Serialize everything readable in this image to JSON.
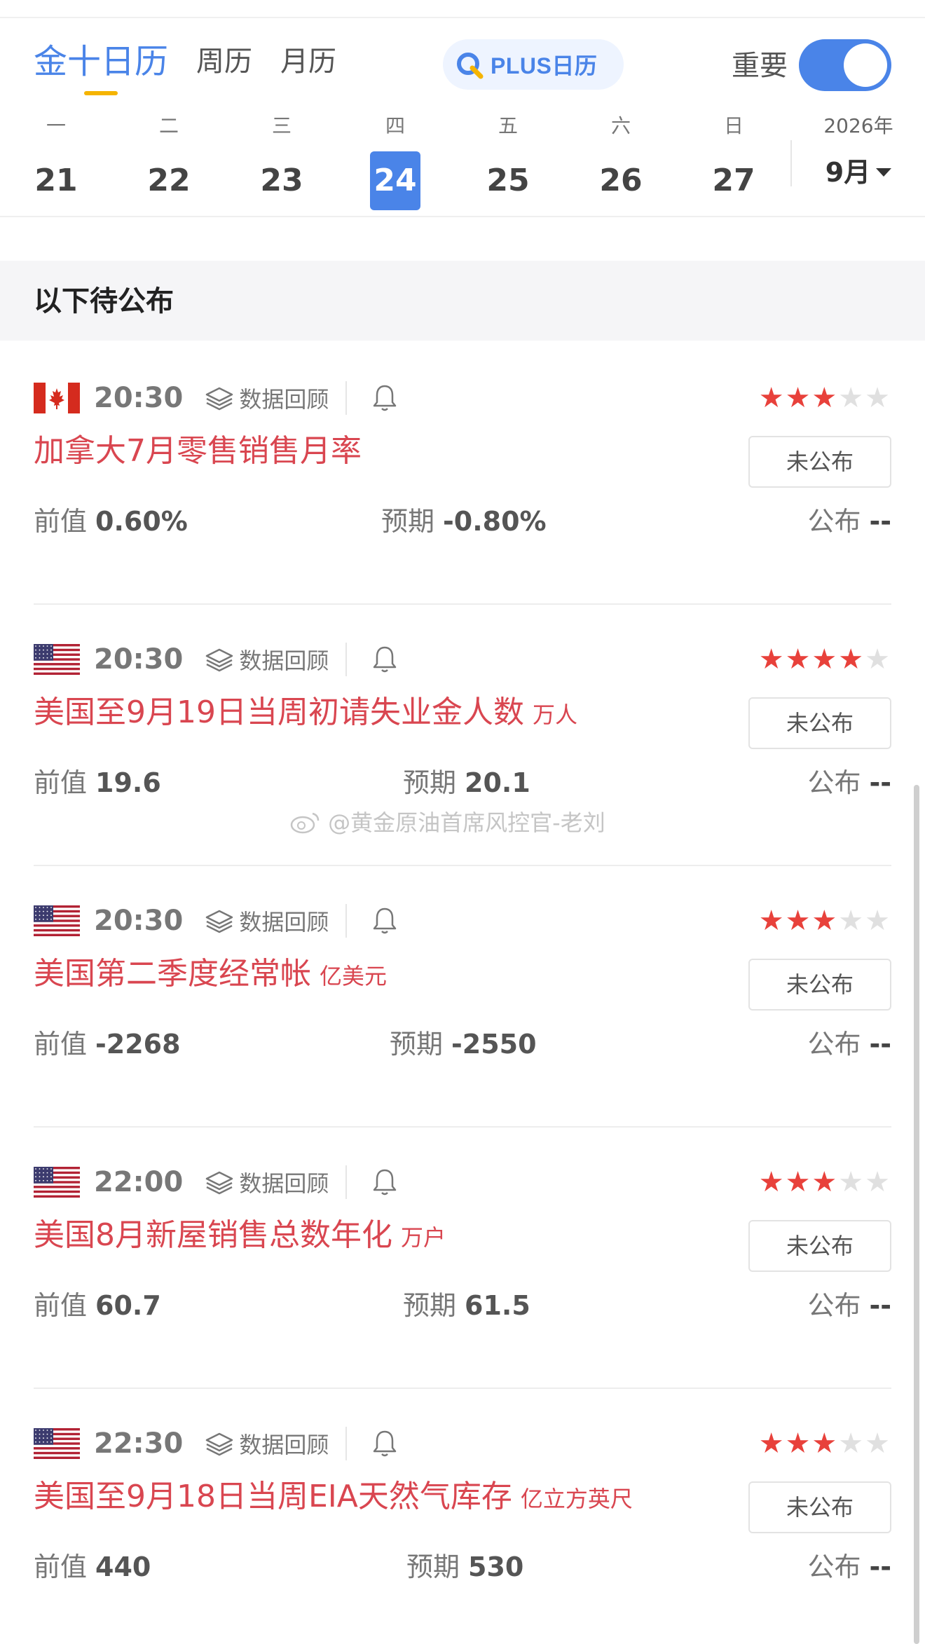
{
  "header": {
    "tabs": [
      {
        "label": "金十日历",
        "active": true
      },
      {
        "label": "周历",
        "active": false
      },
      {
        "label": "月历",
        "active": false
      }
    ],
    "plus_label": "PLUS日历",
    "important_label": "重要",
    "important_on": true
  },
  "week": {
    "days": [
      {
        "weekday": "一",
        "date": "21"
      },
      {
        "weekday": "二",
        "date": "22"
      },
      {
        "weekday": "三",
        "date": "23"
      },
      {
        "weekday": "四",
        "date": "24",
        "selected": true
      },
      {
        "weekday": "五",
        "date": "25"
      },
      {
        "weekday": "六",
        "date": "26"
      },
      {
        "weekday": "日",
        "date": "27"
      }
    ],
    "year": "2026年",
    "month": "9月"
  },
  "section_title": "以下待公布",
  "events": [
    {
      "flag": "canada-flag-icon",
      "time": "20:30",
      "review": "数据回顾",
      "stars": 3,
      "title": "加拿大7月零售销售月率",
      "unit": "",
      "status": "未公布",
      "prev_label": "前值",
      "prev": "0.60%",
      "forecast_label": "预期",
      "forecast": "-0.80%",
      "actual_label": "公布",
      "actual": "--"
    },
    {
      "flag": "usa-flag-icon",
      "time": "20:30",
      "review": "数据回顾",
      "stars": 4,
      "title": "美国至9月19日当周初请失业金人数",
      "unit": "万人",
      "status": "未公布",
      "prev_label": "前值",
      "prev": "19.6",
      "forecast_label": "预期",
      "forecast": "20.1",
      "actual_label": "公布",
      "actual": "--"
    },
    {
      "flag": "usa-flag-icon",
      "time": "20:30",
      "review": "数据回顾",
      "stars": 3,
      "title": "美国第二季度经常帐",
      "unit": "亿美元",
      "status": "未公布",
      "prev_label": "前值",
      "prev": "-2268",
      "forecast_label": "预期",
      "forecast": "-2550",
      "actual_label": "公布",
      "actual": "--"
    },
    {
      "flag": "usa-flag-icon",
      "time": "22:00",
      "review": "数据回顾",
      "stars": 3,
      "title": "美国8月新屋销售总数年化",
      "unit": "万户",
      "status": "未公布",
      "prev_label": "前值",
      "prev": "60.7",
      "forecast_label": "预期",
      "forecast": "61.5",
      "actual_label": "公布",
      "actual": "--"
    },
    {
      "flag": "usa-flag-icon",
      "time": "22:30",
      "review": "数据回顾",
      "stars": 3,
      "title": "美国至9月18日当周EIA天然气库存",
      "unit": "亿立方英尺",
      "status": "未公布",
      "prev_label": "前值",
      "prev": "440",
      "forecast_label": "预期",
      "forecast": "530",
      "actual_label": "公布",
      "actual": "--"
    }
  ],
  "watermark": "@黄金原油首席风控官-老刘",
  "colors": {
    "accent": "#4a84e8",
    "title_red": "#d94650",
    "star_red": "#e8413b",
    "tab_underline": "#f5b400"
  }
}
